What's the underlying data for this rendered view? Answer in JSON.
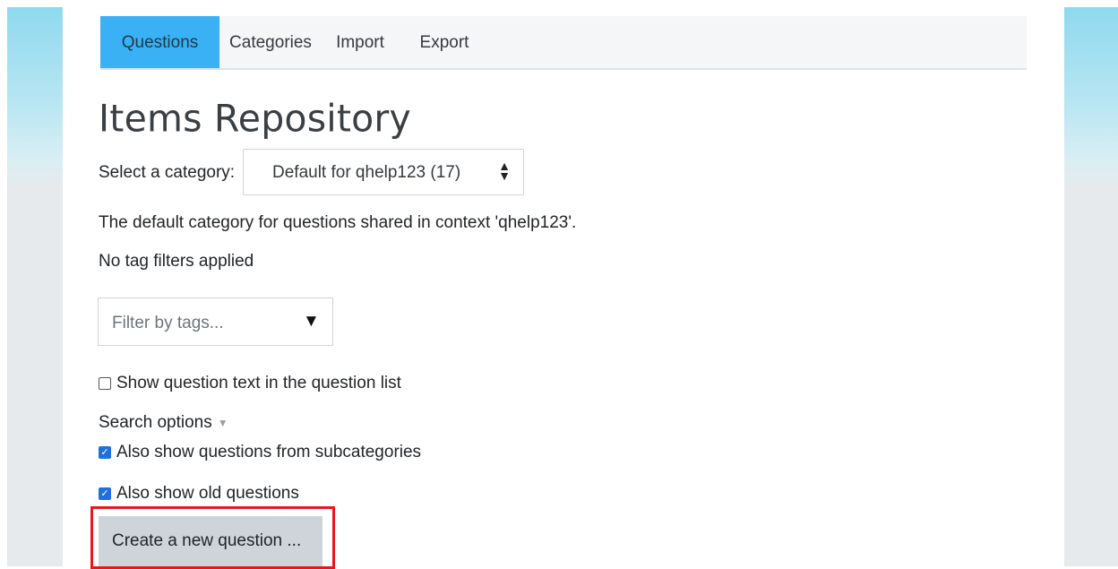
{
  "tabs": [
    {
      "label": "Questions",
      "active": true
    },
    {
      "label": "Categories",
      "active": false
    },
    {
      "label": "Import",
      "active": false
    },
    {
      "label": "Export",
      "active": false
    }
  ],
  "page_title": "Items Repository",
  "category": {
    "label": "Select a category:",
    "selected": "Default for qhelp123 (17)"
  },
  "category_description": "The default category for questions shared in context 'qhelp123'.",
  "tag_status": "No tag filters applied",
  "tag_filter": {
    "placeholder": "Filter by tags..."
  },
  "options": {
    "show_question_text": {
      "label": "Show question text in the question list",
      "checked": false
    },
    "search_options_label": "Search options",
    "subcategories": {
      "label": "Also show questions from subcategories",
      "checked": true
    },
    "old_questions": {
      "label": "Also show old questions",
      "checked": true
    }
  },
  "create_button": {
    "label": "Create a new question ..."
  },
  "colors": {
    "active_tab": "#3ab0f5",
    "highlight_box": "#e8171b",
    "checkbox": "#1e6fe0"
  }
}
